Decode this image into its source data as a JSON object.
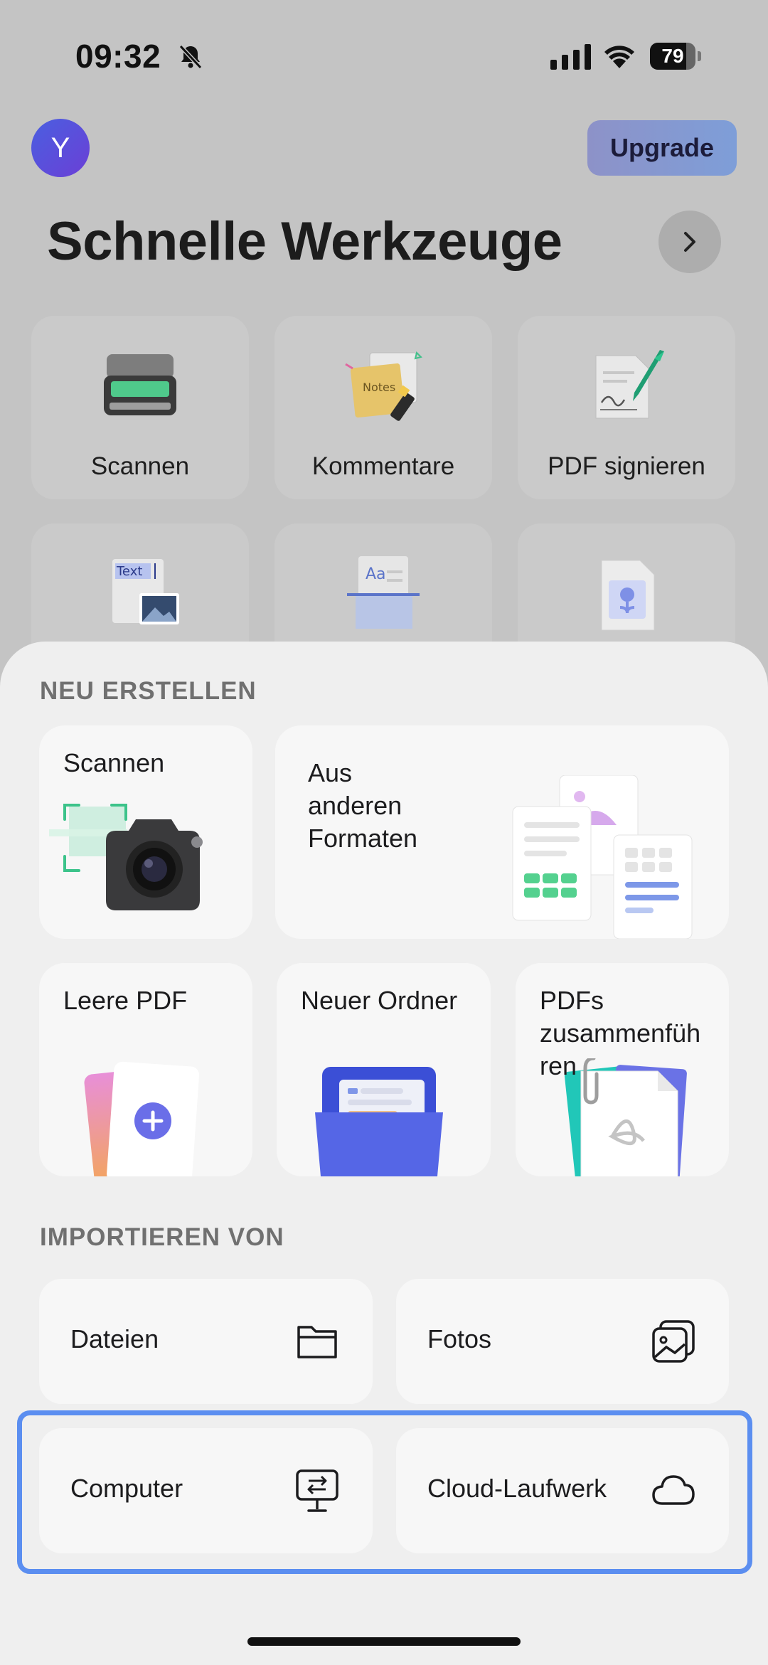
{
  "status_bar": {
    "time": "09:32",
    "battery_percent": "79",
    "battery_level": 0.79
  },
  "header": {
    "avatar_initial": "Y",
    "upgrade_label": "Upgrade",
    "tools_title": "Schnelle Werkzeuge"
  },
  "quick_tools": [
    {
      "label": "Scannen",
      "icon": "scanner-icon"
    },
    {
      "label": "Kommentare",
      "icon": "notes-icon"
    },
    {
      "label": "PDF signieren",
      "icon": "sign-pen-icon"
    },
    {
      "label": "",
      "icon": "text-image-icon"
    },
    {
      "label": "",
      "icon": "typography-icon"
    },
    {
      "label": "",
      "icon": "image-file-icon"
    }
  ],
  "sheet": {
    "create_title": "NEU ERSTELLEN",
    "create": {
      "scan": "Scannen",
      "other_formats": [
        "Aus",
        "anderen",
        "Formaten"
      ],
      "blank_pdf": "Leere PDF",
      "new_folder": "Neuer Ordner",
      "merge": [
        "PDFs",
        "zusammenfüh",
        "ren"
      ]
    },
    "import_title": "IMPORTIEREN VON",
    "import": {
      "files": "Dateien",
      "photos": "Fotos",
      "computer": "Computer",
      "cloud": "Cloud-Laufwerk"
    }
  },
  "colors": {
    "accent": "#5b8ef0",
    "brand": "#5b64e6"
  }
}
